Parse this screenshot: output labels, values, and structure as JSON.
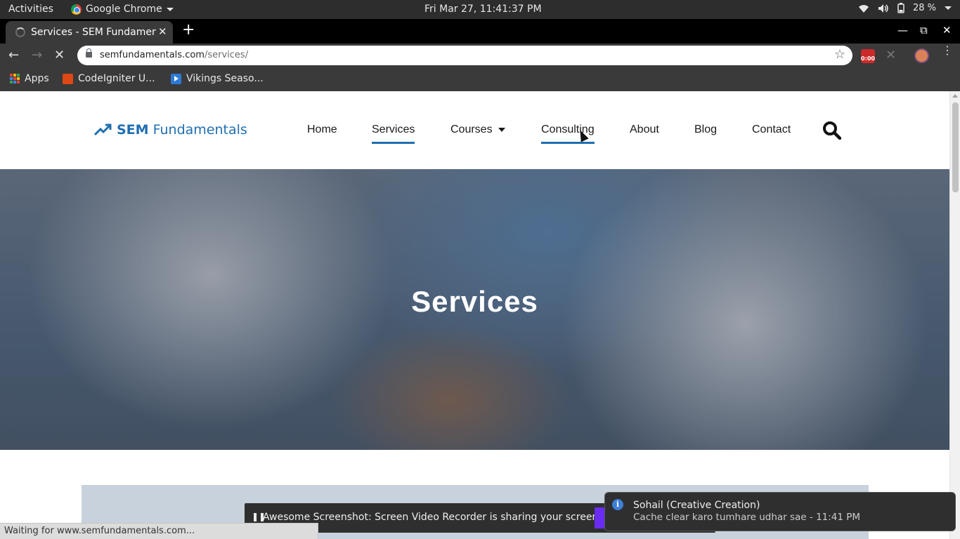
{
  "system_bar": {
    "activities": "Activities",
    "app_name": "Google Chrome",
    "clock": "Fri Mar 27, 11:41:37 PM",
    "battery": "28 %"
  },
  "browser": {
    "tab": {
      "title": "Services - SEM Fundamentals",
      "close_icon": "close-icon"
    },
    "new_tab_label": "+",
    "address": {
      "domain": "semfundamentals.com",
      "path": "/services/"
    },
    "extension_badge": "0:00",
    "bookmarks": [
      {
        "label": "Apps",
        "icon": "apps-grid-icon"
      },
      {
        "label": "CodeIgniter U...",
        "icon": "codeigniter-icon"
      },
      {
        "label": "Vikings Seaso...",
        "icon": "video-icon"
      }
    ]
  },
  "site": {
    "logo": {
      "bold": "SEM",
      "rest": "Fundamentals"
    },
    "nav": [
      {
        "label": "Home"
      },
      {
        "label": "Services"
      },
      {
        "label": "Courses"
      },
      {
        "label": "Consulting"
      },
      {
        "label": "About"
      },
      {
        "label": "Blog"
      },
      {
        "label": "Contact"
      }
    ],
    "active_nav": "Services",
    "hover_nav": "Consulting",
    "accent_color": "#1f6fb0"
  },
  "hero": {
    "title": "Services"
  },
  "status": {
    "text": "Waiting for www.semfundamentals.com..."
  },
  "screen_share": {
    "message": "Awesome Screenshot: Screen Video Recorder is sharing your screen."
  },
  "notification": {
    "title": "Sohail (Creative Creation)",
    "body": "Cache clear karo tumhare udhar sae - 11:41 PM"
  }
}
